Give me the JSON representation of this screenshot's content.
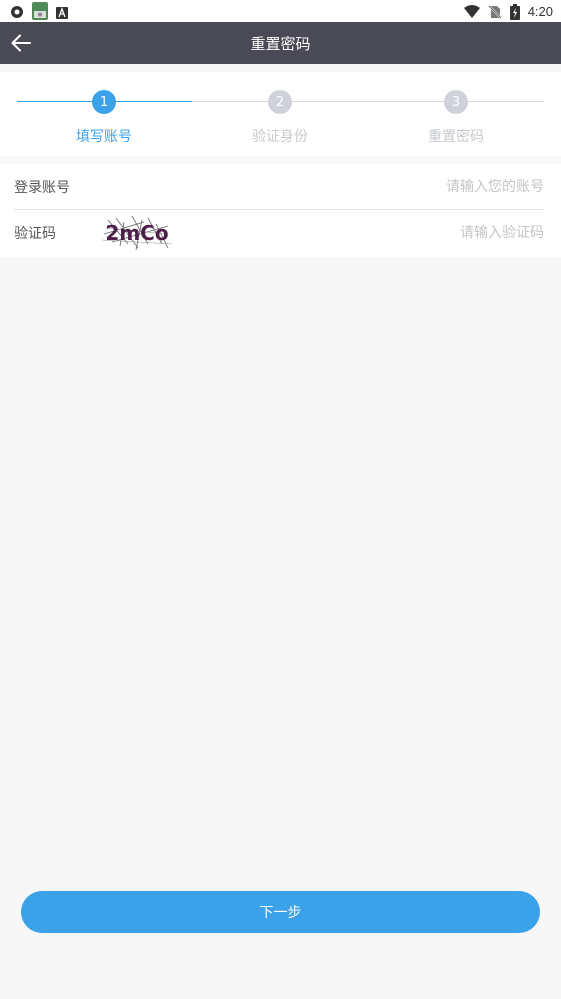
{
  "status_bar": {
    "time": "4:20",
    "icons": [
      "chat-bubble-icon",
      "app-icon",
      "a-badge-icon",
      "wifi-icon",
      "no-sim-icon",
      "battery-charging-icon"
    ]
  },
  "header": {
    "title": "重置密码",
    "back_icon": "arrow-left-icon"
  },
  "steps": [
    {
      "number": "1",
      "label": "填写账号",
      "active": true
    },
    {
      "number": "2",
      "label": "验证身份",
      "active": false
    },
    {
      "number": "3",
      "label": "重置密码",
      "active": false
    }
  ],
  "form": {
    "account": {
      "label": "登录账号",
      "value": "",
      "placeholder": "请输入您的账号"
    },
    "captcha": {
      "label": "验证码",
      "image_text": "2mCo",
      "value": "",
      "placeholder": "请输入验证码"
    }
  },
  "next_button": {
    "label": "下一步"
  },
  "colors": {
    "accent": "#3ba1e8",
    "header_bg": "#4a4a57",
    "inactive": "#cfd2d8",
    "page_bg": "#f7f7f7"
  }
}
